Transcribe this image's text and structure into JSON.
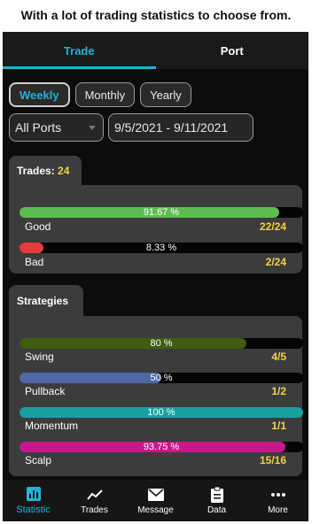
{
  "caption": "With a lot of trading statistics to choose from.",
  "tabs": [
    {
      "label": "Trade",
      "active": true
    },
    {
      "label": "Port",
      "active": false
    }
  ],
  "periods": [
    {
      "label": "Weekly",
      "active": true
    },
    {
      "label": "Monthly",
      "active": false
    },
    {
      "label": "Yearly",
      "active": false
    }
  ],
  "filters": {
    "ports": "All Ports",
    "date_range": "9/5/2021 - 9/11/2021"
  },
  "trades_card": {
    "title": "Trades:",
    "total": "24",
    "rows": [
      {
        "label": "Good",
        "percent_text": "91.67 %",
        "fraction": 0.9167,
        "count": "22/24",
        "color": "#5cbd50"
      },
      {
        "label": "Bad",
        "percent_text": "8.33 %",
        "fraction": 0.0833,
        "count": "2/24",
        "color": "#e53b3b"
      }
    ]
  },
  "strategies_card": {
    "title": "Strategies",
    "rows": [
      {
        "label": "Swing",
        "percent_text": "80 %",
        "fraction": 0.8,
        "count": "4/5",
        "color": "#3f5e0c"
      },
      {
        "label": "Pullback",
        "percent_text": "50 %",
        "fraction": 0.5,
        "count": "1/2",
        "color": "#4d6aa6"
      },
      {
        "label": "Momentum",
        "percent_text": "100 %",
        "fraction": 1.0,
        "count": "1/1",
        "color": "#1a9fa3"
      },
      {
        "label": "Scalp",
        "percent_text": "93.75 %",
        "fraction": 0.9375,
        "count": "15/16",
        "color": "#c8168e"
      }
    ]
  },
  "bottom_nav": [
    {
      "label": "Statistic",
      "icon": "bar-chart-icon",
      "active": true
    },
    {
      "label": "Trades",
      "icon": "trend-line-icon",
      "active": false
    },
    {
      "label": "Message",
      "icon": "envelope-icon",
      "active": false
    },
    {
      "label": "Data",
      "icon": "clipboard-icon",
      "active": false
    },
    {
      "label": "More",
      "icon": "dots-icon",
      "active": false
    }
  ],
  "accent_color": "#22b3d6",
  "highlight_color": "#f3d24a"
}
